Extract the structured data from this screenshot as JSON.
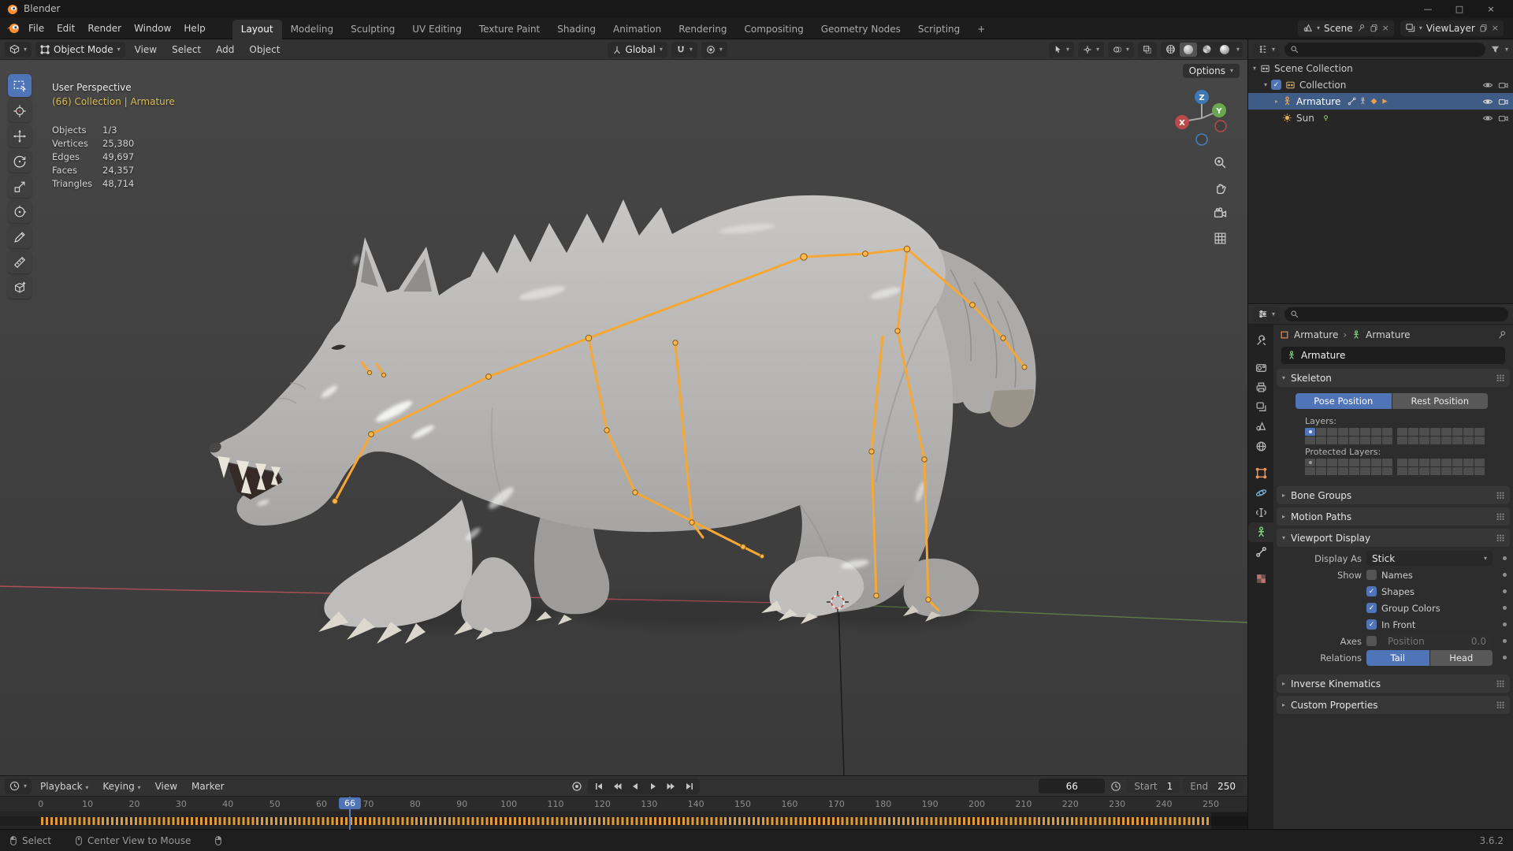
{
  "window": {
    "title": "Blender",
    "minimize": "—",
    "maximize": "□",
    "close": "×"
  },
  "topbar": {
    "menus": [
      "File",
      "Edit",
      "Render",
      "Window",
      "Help"
    ],
    "tabs": [
      "Layout",
      "Modeling",
      "Sculpting",
      "UV Editing",
      "Texture Paint",
      "Shading",
      "Animation",
      "Rendering",
      "Compositing",
      "Geometry Nodes",
      "Scripting",
      "+"
    ],
    "scene": {
      "label": "Scene"
    },
    "viewlayer": {
      "label": "ViewLayer"
    }
  },
  "viewport_header": {
    "mode": "Object Mode",
    "menus": [
      "View",
      "Select",
      "Add",
      "Object"
    ],
    "orientation": "Global",
    "options": "Options"
  },
  "viewport": {
    "view_label": "User Perspective",
    "context_label": "(66) Collection | Armature",
    "stats": [
      {
        "label": "Objects",
        "value": "1/3"
      },
      {
        "label": "Vertices",
        "value": "25,380"
      },
      {
        "label": "Edges",
        "value": "49,697"
      },
      {
        "label": "Faces",
        "value": "24,357"
      },
      {
        "label": "Triangles",
        "value": "48,714"
      }
    ],
    "gizmo": {
      "x": "X",
      "y": "Y",
      "z": "Z"
    }
  },
  "outliner": {
    "rows": [
      {
        "label": "Scene Collection"
      },
      {
        "label": "Collection"
      },
      {
        "label": "Armature"
      },
      {
        "label": "Sun"
      }
    ]
  },
  "properties": {
    "breadcrumb": {
      "object": "Armature",
      "data": "Armature"
    },
    "name": "Armature",
    "skeleton": {
      "title": "Skeleton",
      "pose": "Pose Position",
      "rest": "Rest Position",
      "layers": "Layers:",
      "protected": "Protected Layers:"
    },
    "sections": {
      "bone_groups": "Bone Groups",
      "motion_paths": "Motion Paths",
      "viewport_display": "Viewport Display",
      "inverse_kinematics": "Inverse Kinematics",
      "custom_properties": "Custom Properties"
    },
    "display": {
      "display_as_label": "Display As",
      "display_as": "Stick",
      "show_label": "Show",
      "names": "Names",
      "shapes": "Shapes",
      "group_colors": "Group Colors",
      "in_front": "In Front",
      "axes_label": "Axes",
      "position_label": "Position",
      "position_value": "0.0",
      "relations_label": "Relations",
      "tail": "Tail",
      "head": "Head"
    }
  },
  "timeline": {
    "menus": [
      "Playback",
      "Keying",
      "View",
      "Marker"
    ],
    "current_frame": "66",
    "start_label": "Start",
    "start_value": "1",
    "end_label": "End",
    "end_value": "250",
    "ruler": [
      "0",
      "10",
      "20",
      "30",
      "40",
      "50",
      "60",
      "70",
      "80",
      "90",
      "100",
      "110",
      "120",
      "130",
      "140",
      "150",
      "160",
      "170",
      "180",
      "190",
      "200",
      "210",
      "220",
      "230",
      "240",
      "250"
    ]
  },
  "statusbar": {
    "select": "Select",
    "center_view": "Center View to Mouse",
    "version": "3.6.2"
  }
}
